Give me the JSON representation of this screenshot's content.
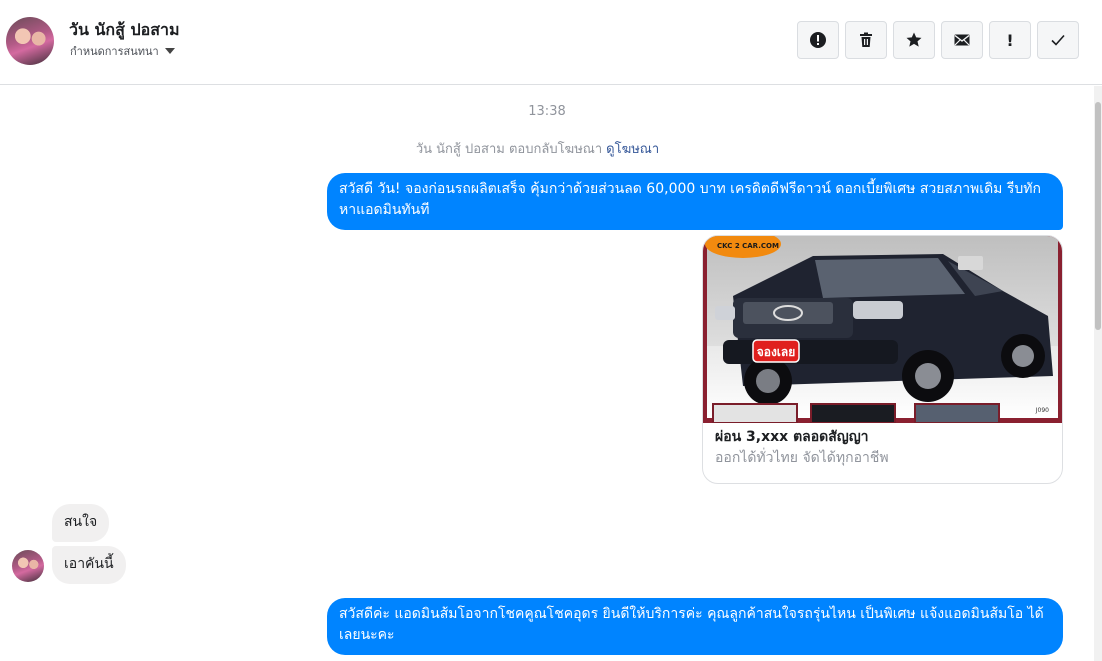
{
  "header": {
    "contact_name": "วัน นักสู้ ปอสาม",
    "subtitle": "กำหนดการสนทนา",
    "toolbar": [
      {
        "name": "report-spam-button",
        "icon": "alert-circle-icon"
      },
      {
        "name": "delete-button",
        "icon": "trash-icon"
      },
      {
        "name": "star-button",
        "icon": "star-icon"
      },
      {
        "name": "mark-unread-button",
        "icon": "envelope-icon"
      },
      {
        "name": "follow-up-button",
        "label": "!"
      },
      {
        "name": "mark-done-button",
        "icon": "check-icon"
      }
    ]
  },
  "chat": {
    "timestamp": "13:38",
    "ad_note": "วัน นักสู้ ปอสาม ตอบกลับโฆษณา",
    "ad_link": "ดูโฆษณา",
    "messages": [
      {
        "direction": "out",
        "text": "สวัสดี วัน! จองก่อนรถผลิตเสร็จ คุ้มกว่าด้วยส่วนลด 60,000 บาท เครดิตดีฟรีดาวน์ ดอกเบี้ยพิเศษ สวยสภาพเดิม รีบทักหาแอดมินทันที"
      },
      {
        "direction": "in",
        "text": "สนใจ"
      },
      {
        "direction": "in",
        "text": "เอาคันนี้"
      },
      {
        "direction": "out",
        "text": "สวัสดีค่ะ แอดมินส้มโอจากโชคคูณโชคอุดร ยินดีให้บริการค่ะ  คุณลูกค้าสนใจรถรุ่นไหน เป็นพิเศษ แจ้งแอดมินส้มโอ ได้เลยนะคะ"
      }
    ],
    "ad_card": {
      "title": "ผ่อน 3,xxx ตลอดสัญญา",
      "description": "ออกได้ทั่วไทย จัดได้ทุกอาชีพ",
      "image_badge": "จองเลย",
      "image_logo": "CKC 2 CAR.COM",
      "image_code": "J090"
    }
  },
  "colors": {
    "outgoing": "#0084ff",
    "incoming": "#f1f0f0",
    "link": "#365899"
  }
}
